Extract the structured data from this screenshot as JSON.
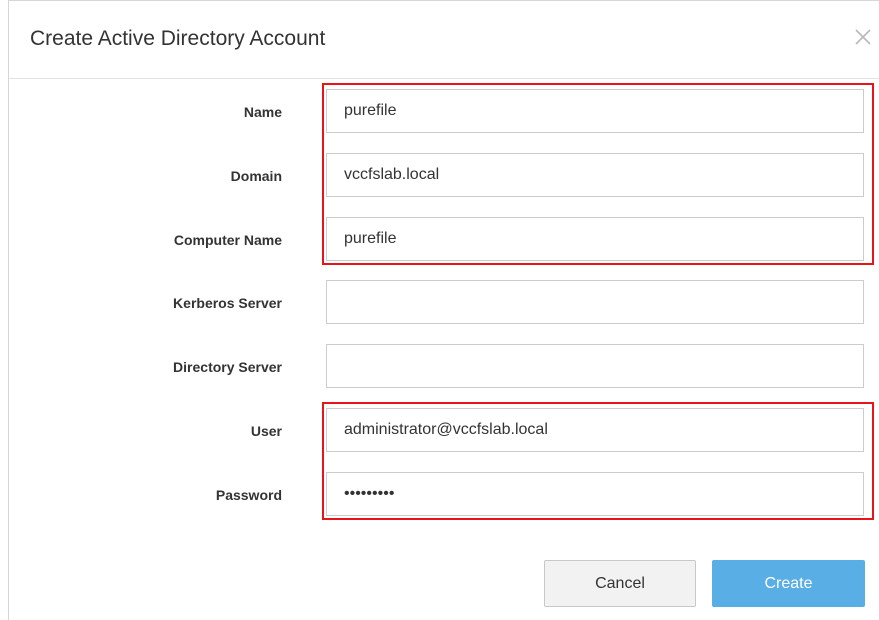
{
  "dialog": {
    "title": "Create Active Directory Account",
    "close_icon": "close-icon"
  },
  "form": {
    "fields": [
      {
        "label": "Name",
        "value": "purefile",
        "type": "text"
      },
      {
        "label": "Domain",
        "value": "vccfslab.local",
        "type": "text"
      },
      {
        "label": "Computer Name",
        "value": "purefile",
        "type": "text"
      },
      {
        "label": "Kerberos Server",
        "value": "",
        "type": "text"
      },
      {
        "label": "Directory Server",
        "value": "",
        "type": "text"
      },
      {
        "label": "User",
        "value": "administrator@vccfslab.local",
        "type": "text"
      },
      {
        "label": "Password",
        "value": "•••••••••",
        "type": "password"
      }
    ]
  },
  "buttons": {
    "cancel": "Cancel",
    "create": "Create"
  },
  "colors": {
    "highlight": "#e8141c",
    "primary_button": "#5aaee6",
    "secondary_button": "#f2f2f2"
  }
}
